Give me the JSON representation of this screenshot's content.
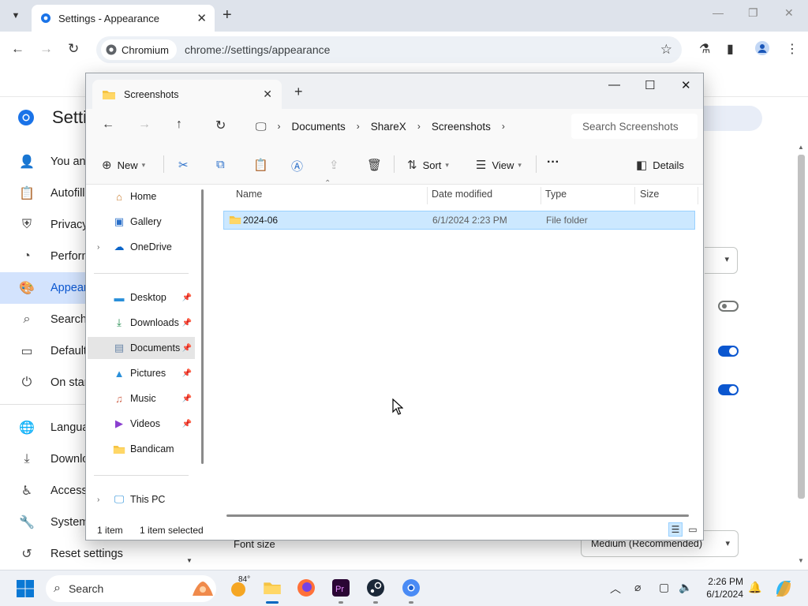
{
  "browser": {
    "tab_title": "Settings - Appearance",
    "omnibox_chip": "Chromium",
    "url": "chrome://settings/appearance"
  },
  "settings": {
    "title": "Setti",
    "nav": [
      {
        "label": "You and",
        "icon": "person-icon"
      },
      {
        "label": "Autofill",
        "icon": "clipboard-icon"
      },
      {
        "label": "Privacy",
        "icon": "shield-icon"
      },
      {
        "label": "Perform",
        "icon": "speedometer-icon"
      },
      {
        "label": "Appear",
        "icon": "palette-icon"
      },
      {
        "label": "Search",
        "icon": "search-icon"
      },
      {
        "label": "Default",
        "icon": "browser-icon"
      },
      {
        "label": "On star",
        "icon": "power-icon"
      },
      {
        "label": "Langua",
        "icon": "globe-icon"
      },
      {
        "label": "Downlo",
        "icon": "download-icon"
      },
      {
        "label": "Accessi",
        "icon": "accessibility-icon"
      },
      {
        "label": "System",
        "icon": "wrench-icon"
      },
      {
        "label": "Reset settings",
        "icon": "history-icon"
      }
    ],
    "font_size_label": "Font size",
    "font_size_value": "Medium (Recommended)"
  },
  "explorer": {
    "tab_title": "Screenshots",
    "breadcrumb": [
      "Documents",
      "ShareX",
      "Screenshots"
    ],
    "search_placeholder": "Search Screenshots",
    "commands": {
      "new": "New",
      "sort": "Sort",
      "view": "View",
      "more": "···",
      "details": "Details"
    },
    "nav_pane": {
      "top": [
        "Home",
        "Gallery",
        "OneDrive"
      ],
      "quick": [
        "Desktop",
        "Downloads",
        "Documents",
        "Pictures",
        "Music",
        "Videos",
        "Bandicam"
      ],
      "bottom": [
        "This PC"
      ]
    },
    "columns": [
      "Name",
      "Date modified",
      "Type",
      "Size"
    ],
    "files": [
      {
        "name": "2024-06",
        "date": "6/1/2024 2:23 PM",
        "type": "File folder",
        "size": ""
      }
    ],
    "status": {
      "count": "1 item",
      "selected": "1 item selected"
    }
  },
  "taskbar": {
    "search_label": "Search",
    "weather_temp": "84°",
    "time": "2:26 PM",
    "date": "6/1/2024"
  },
  "colors": {
    "accent": "#0b57d0",
    "selection": "#cce8ff",
    "folder": "#f5c342"
  }
}
